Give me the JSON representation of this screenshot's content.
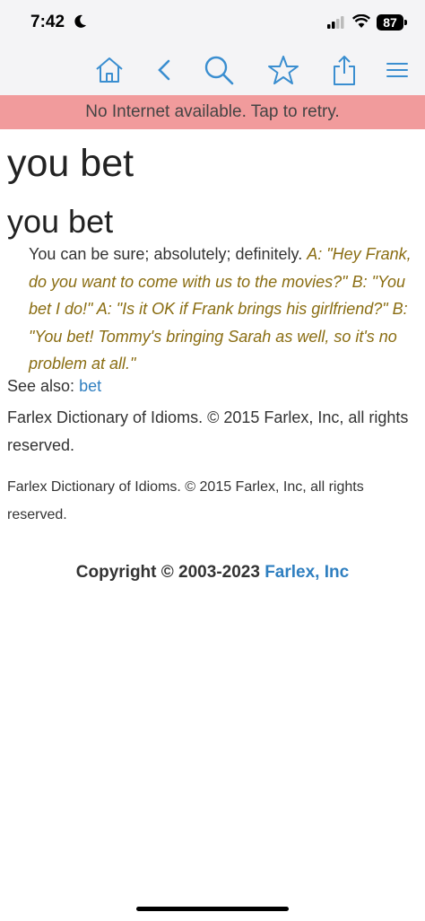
{
  "status": {
    "time": "7:42",
    "battery": "87"
  },
  "banner": {
    "text": "No Internet available. Tap to retry."
  },
  "entry": {
    "title": "you bet",
    "headword": "you bet",
    "definition": "You can be sure; absolutely; definitely.",
    "example": "A: \"Hey Frank, do you want to come with us to the movies?\" B: \"You bet I do!\" A: \"Is it OK if Frank brings his girlfriend?\" B: \"You bet! Tommy's bringing Sarah as well, so it's no problem at all.\"",
    "see_also_label": "See also:",
    "see_also_link": "bet",
    "source_credit": "Farlex Dictionary of Idioms. © 2015 Farlex, Inc, all rights reserved.",
    "source_credit_small": "Farlex Dictionary of Idioms. © 2015 Farlex, Inc, all rights reserved."
  },
  "footer": {
    "copyright_text": "Copyright © 2003-2023",
    "company_link": "Farlex, Inc"
  },
  "toolbar": {
    "icons": [
      "home-icon",
      "back-icon",
      "search-icon",
      "star-icon",
      "share-icon",
      "menu-icon"
    ]
  },
  "colors": {
    "accent": "#3a8ed0",
    "banner": "#f19b9c",
    "example": "#8a6d12",
    "link": "#2f7fc0"
  }
}
